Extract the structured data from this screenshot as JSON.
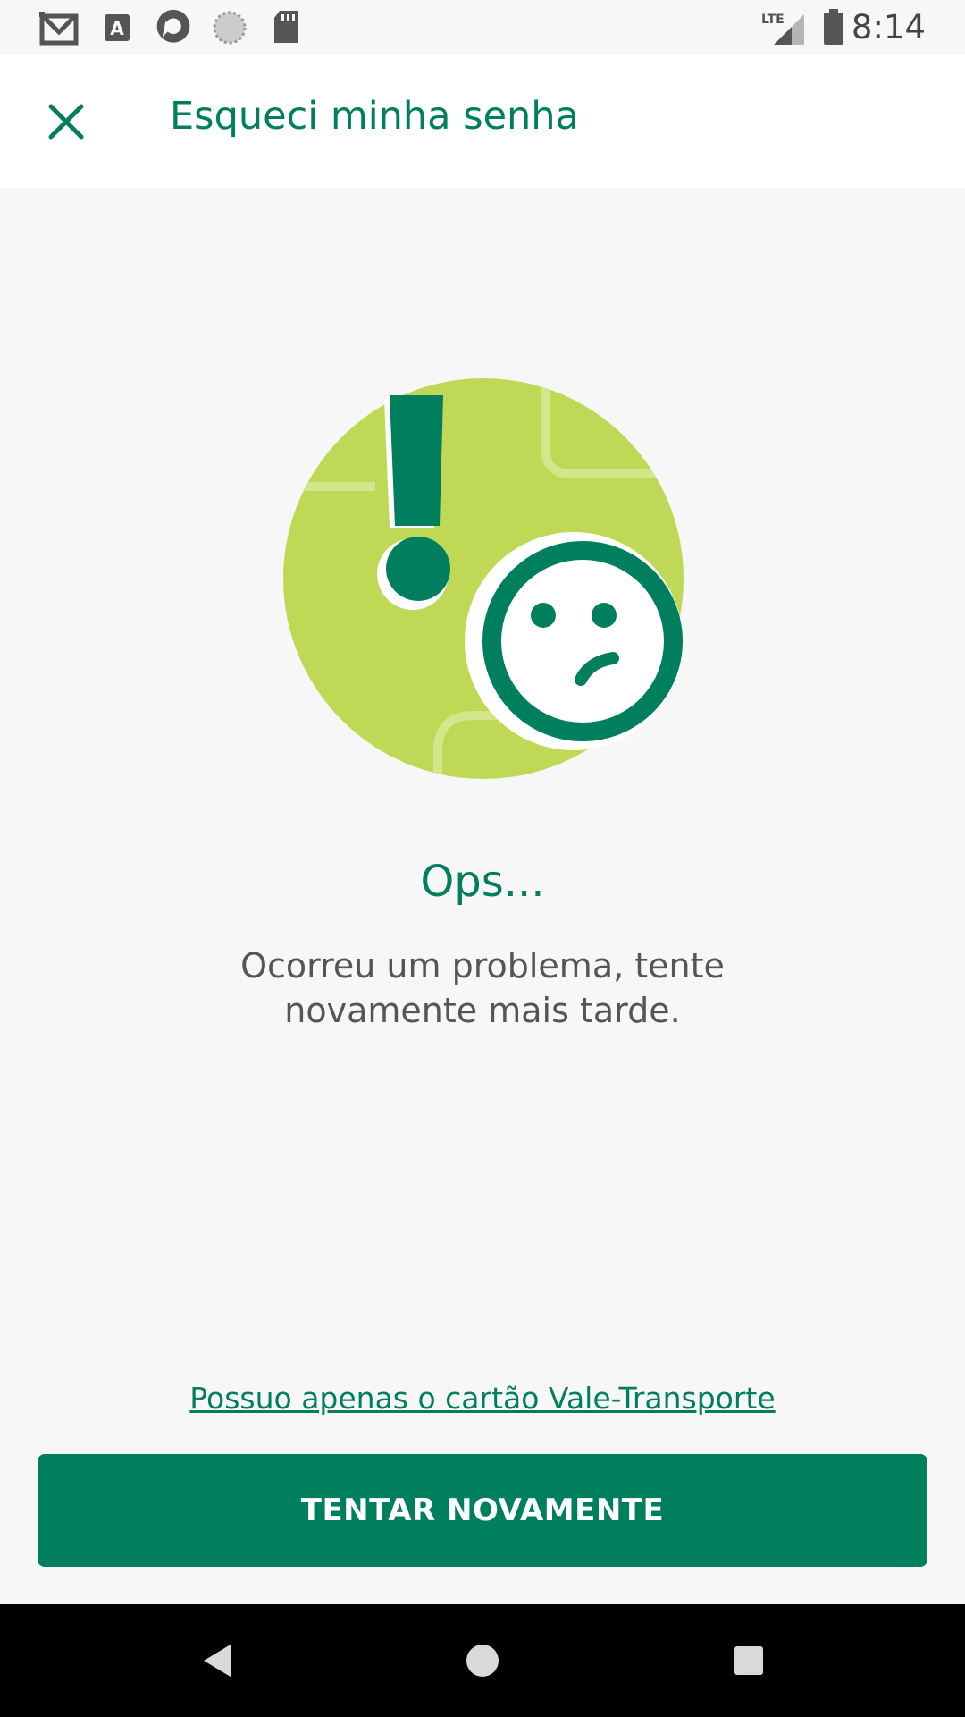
{
  "status_bar": {
    "time": "8:14",
    "network": "LTE",
    "notification_icons": [
      "gmail-icon",
      "font-icon",
      "sync-app-icon",
      "loading-icon",
      "sd-card-icon"
    ]
  },
  "app_bar": {
    "close_icon": "close-icon",
    "title": "Esqueci minha senha"
  },
  "error": {
    "illustration": "sad-face-alert-illustration",
    "title": "Ops...",
    "message": "Ocorreu um problema, tente novamente mais tarde."
  },
  "actions": {
    "link_label": "Possuo apenas o cartão Vale-Transporte",
    "button_label": "TENTAR NOVAMENTE"
  },
  "nav_bar": {
    "icons": [
      "back-icon",
      "home-icon",
      "recents-icon"
    ]
  },
  "colors": {
    "brand_green": "#007f5f",
    "light_green": "#bfd957",
    "background": "#f7f7f7",
    "text_gray": "#555555"
  }
}
